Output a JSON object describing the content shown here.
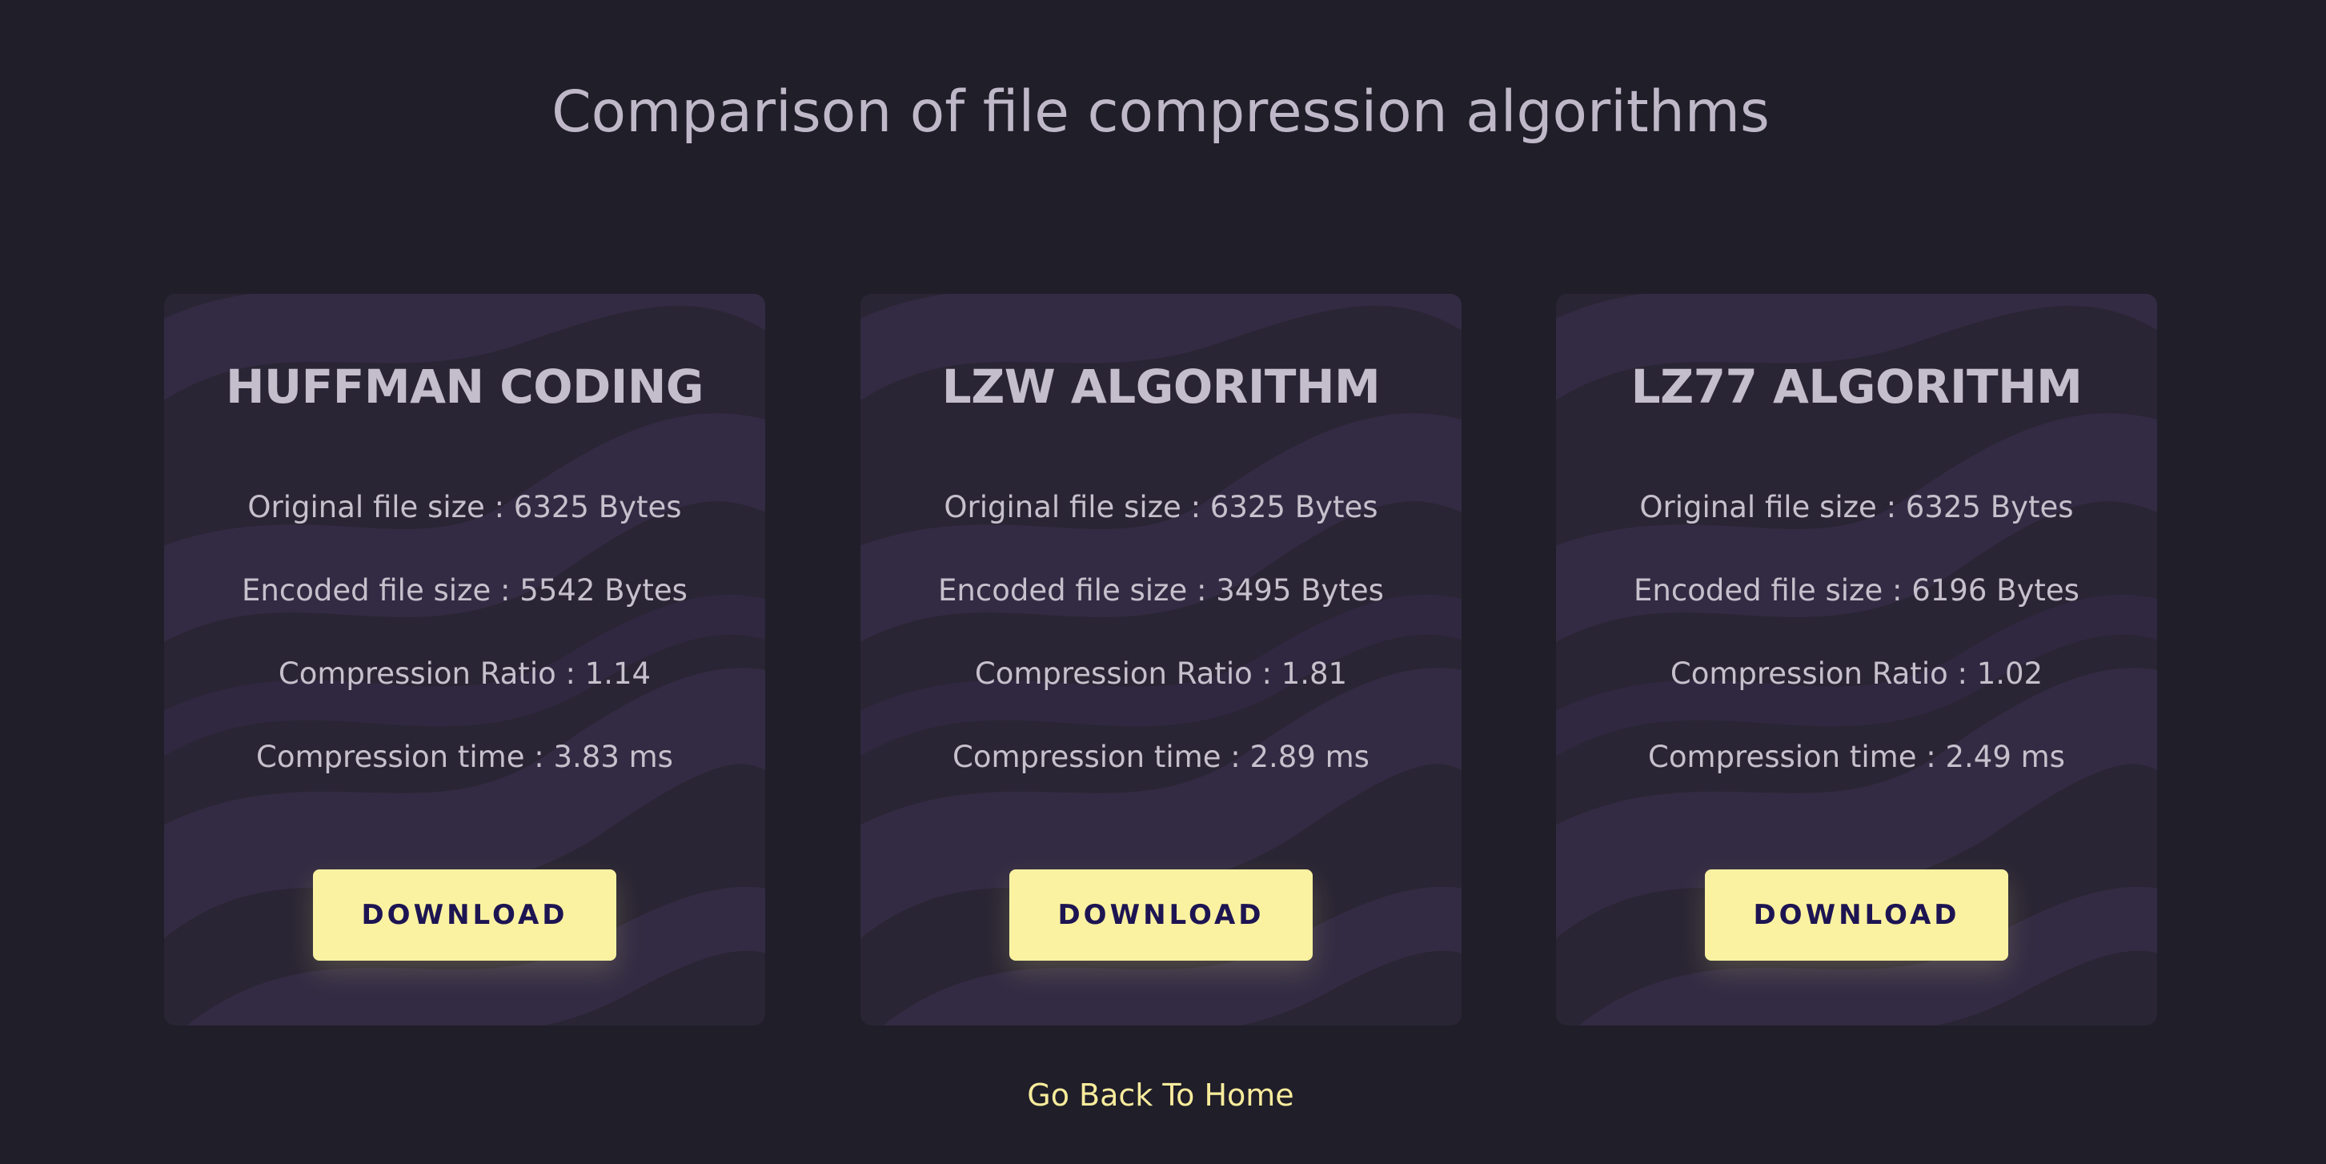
{
  "page": {
    "title": "Comparison of file compression algorithms"
  },
  "cards": [
    {
      "title": "HUFFMAN CODING",
      "original_size": "Original file size : 6325 Bytes",
      "encoded_size": "Encoded file size : 5542 Bytes",
      "compression_ratio": "Compression Ratio : 1.14",
      "compression_time": "Compression time : 3.83 ms",
      "download_label": "DOWNLOAD"
    },
    {
      "title": "LZW ALGORITHM",
      "original_size": "Original file size : 6325 Bytes",
      "encoded_size": "Encoded file size : 3495 Bytes",
      "compression_ratio": "Compression Ratio : 1.81",
      "compression_time": "Compression time : 2.89 ms",
      "download_label": "DOWNLOAD"
    },
    {
      "title": "LZ77 ALGORITHM",
      "original_size": "Original file size : 6325 Bytes",
      "encoded_size": "Encoded file size : 6196 Bytes",
      "compression_ratio": "Compression Ratio : 1.02",
      "compression_time": "Compression time : 2.49 ms",
      "download_label": "DOWNLOAD"
    }
  ],
  "footer": {
    "home_link": "Go Back To Home"
  },
  "colors": {
    "background": "#201e29",
    "card_background": "#2a2534",
    "card_pattern": "#342c45",
    "heading_text": "#bfb8c8",
    "body_text": "#c6c0cc",
    "button_background": "#fbf2a1",
    "button_text": "#1d1552",
    "link_text": "#f8ec9c"
  }
}
